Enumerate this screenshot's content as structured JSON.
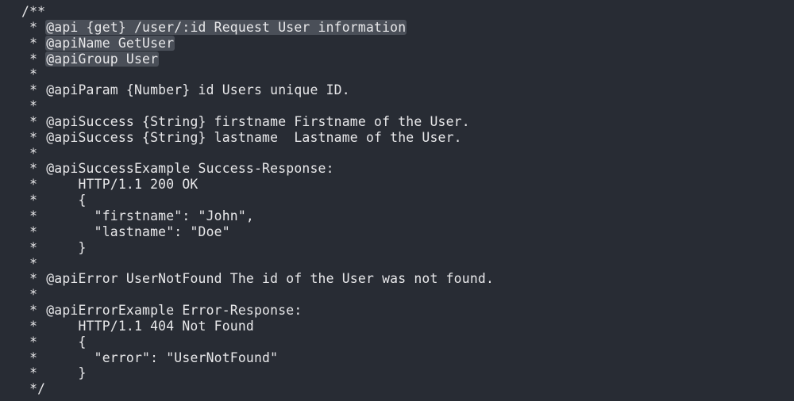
{
  "editor": {
    "colors": {
      "background": "#282c34",
      "text": "#e8e8ea",
      "selection": "#4a4f58"
    },
    "lines": [
      {
        "prefix": "/**",
        "text": "",
        "selected": false
      },
      {
        "prefix": " * ",
        "text": "@api {get} /user/:id Request User information",
        "selected": true
      },
      {
        "prefix": " * ",
        "text": "@apiName GetUser",
        "selected": true
      },
      {
        "prefix": " * ",
        "text": "@apiGroup User",
        "selected": true
      },
      {
        "prefix": " *",
        "text": "",
        "selected": false
      },
      {
        "prefix": " * ",
        "text": "@apiParam {Number} id Users unique ID.",
        "selected": false
      },
      {
        "prefix": " *",
        "text": "",
        "selected": false
      },
      {
        "prefix": " * ",
        "text": "@apiSuccess {String} firstname Firstname of the User.",
        "selected": false
      },
      {
        "prefix": " * ",
        "text": "@apiSuccess {String} lastname  Lastname of the User.",
        "selected": false
      },
      {
        "prefix": " *",
        "text": "",
        "selected": false
      },
      {
        "prefix": " * ",
        "text": "@apiSuccessExample Success-Response:",
        "selected": false
      },
      {
        "prefix": " *     ",
        "text": "HTTP/1.1 200 OK",
        "selected": false
      },
      {
        "prefix": " *     ",
        "text": "{",
        "selected": false
      },
      {
        "prefix": " *       ",
        "text": "\"firstname\": \"John\",",
        "selected": false
      },
      {
        "prefix": " *       ",
        "text": "\"lastname\": \"Doe\"",
        "selected": false
      },
      {
        "prefix": " *     ",
        "text": "}",
        "selected": false
      },
      {
        "prefix": " *",
        "text": "",
        "selected": false
      },
      {
        "prefix": " * ",
        "text": "@apiError UserNotFound The id of the User was not found.",
        "selected": false
      },
      {
        "prefix": " *",
        "text": "",
        "selected": false
      },
      {
        "prefix": " * ",
        "text": "@apiErrorExample Error-Response:",
        "selected": false
      },
      {
        "prefix": " *     ",
        "text": "HTTP/1.1 404 Not Found",
        "selected": false
      },
      {
        "prefix": " *     ",
        "text": "{",
        "selected": false
      },
      {
        "prefix": " *       ",
        "text": "\"error\": \"UserNotFound\"",
        "selected": false
      },
      {
        "prefix": " *     ",
        "text": "}",
        "selected": false
      },
      {
        "prefix": " */",
        "text": "",
        "selected": false
      }
    ]
  }
}
